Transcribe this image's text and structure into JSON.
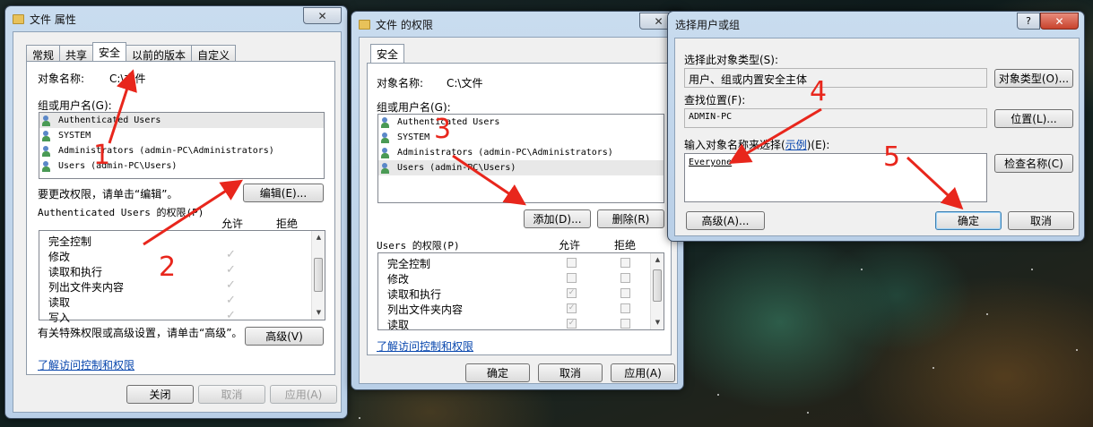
{
  "win1": {
    "title": "文件 属性",
    "close": "✕",
    "tabs": [
      "常规",
      "共享",
      "安全",
      "以前的版本",
      "自定义"
    ],
    "object_label": "对象名称:",
    "object_value": "C:\\文件",
    "group_label": "组或用户名(G):",
    "users": [
      "Authenticated Users",
      "SYSTEM",
      "Administrators (admin-PC\\Administrators)",
      "Users (admin-PC\\Users)"
    ],
    "change_hint": "要更改权限，请单击“编辑”。",
    "edit_button": "编辑(E)...",
    "perm_title": "Authenticated Users 的权限(P)",
    "allow": "允许",
    "deny": "拒绝",
    "permissions": [
      "完全控制",
      "修改",
      "读取和执行",
      "列出文件夹内容",
      "读取",
      "写入"
    ],
    "allow_checks": [
      false,
      true,
      true,
      true,
      true,
      true
    ],
    "special_hint": "有关特殊权限或高级设置，请单击“高级”。",
    "advanced_button": "高级(V)",
    "learn_link": "了解访问控制和权限",
    "ok": "关闭",
    "cancel": "取消",
    "apply": "应用(A)"
  },
  "win2": {
    "title": "文件 的权限",
    "close": "✕",
    "tab": "安全",
    "object_label": "对象名称:",
    "object_value": "C:\\文件",
    "group_label": "组或用户名(G):",
    "users": [
      "Authenticated Users",
      "SYSTEM",
      "Administrators (admin-PC\\Administrators)",
      "Users (admin-PC\\Users)"
    ],
    "add_button": "添加(D)...",
    "remove_button": "删除(R)",
    "perm_title": "Users 的权限(P)",
    "allow": "允许",
    "deny": "拒绝",
    "permissions": [
      "完全控制",
      "修改",
      "读取和执行",
      "列出文件夹内容",
      "读取"
    ],
    "allow_checks": [
      false,
      false,
      true,
      true,
      true
    ],
    "learn_link": "了解访问控制和权限",
    "ok": "确定",
    "cancel": "取消",
    "apply": "应用(A)"
  },
  "win3": {
    "title": "选择用户或组",
    "help": "?",
    "close": "✕",
    "type_label": "选择此对象类型(S):",
    "type_value": "用户、组或内置安全主体",
    "type_button": "对象类型(O)...",
    "loc_label": "查找位置(F):",
    "loc_value": "ADMIN-PC",
    "loc_button": "位置(L)...",
    "enter_label_a": "输入对象名称来选择(",
    "enter_label_link": "示例",
    "enter_label_b": ")(E):",
    "enter_value": "Everyone",
    "check_button": "检查名称(C)",
    "advanced_button": "高级(A)...",
    "ok": "确定",
    "cancel": "取消"
  },
  "annotations": [
    "1",
    "2",
    "3",
    "4",
    "5"
  ],
  "colors": {
    "arrow": "#e8261c",
    "titlebar": "#c4d8ed",
    "dialog_bg": "#f0f0f0"
  }
}
